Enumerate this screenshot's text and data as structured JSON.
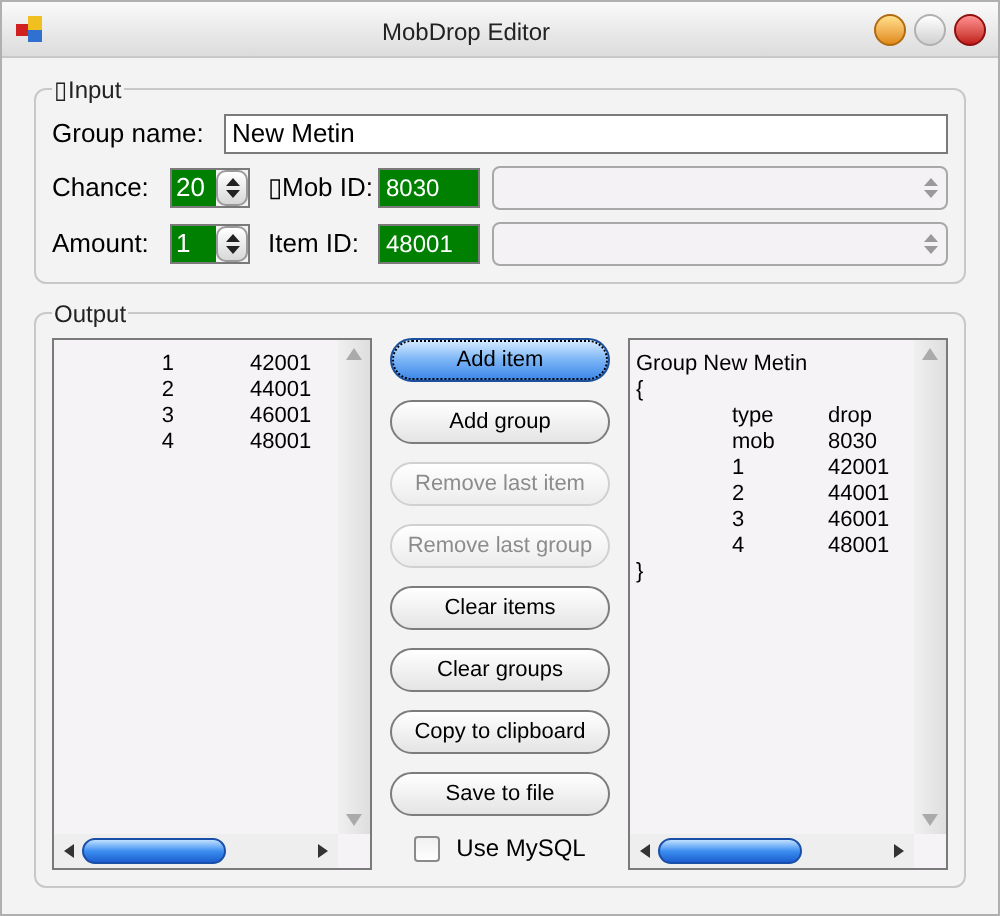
{
  "window": {
    "title": "MobDrop Editor"
  },
  "input": {
    "title": "▯Input",
    "group_name_label": "Group name:",
    "group_name": "New Metin",
    "chance_label": "Chance:",
    "chance": "20",
    "mob_id_label": "▯Mob ID:",
    "mob_id": "8030",
    "amount_label": "Amount:",
    "amount": "1",
    "item_id_label": "Item ID:",
    "item_id": "48001"
  },
  "output": {
    "title": "Output",
    "items": [
      {
        "index": "1",
        "id": "42001"
      },
      {
        "index": "2",
        "id": "44001"
      },
      {
        "index": "3",
        "id": "46001"
      },
      {
        "index": "4",
        "id": "48001"
      }
    ],
    "buttons": [
      {
        "label": "Add item",
        "default": true,
        "disabled": false
      },
      {
        "label": "Add group",
        "default": false,
        "disabled": false
      },
      {
        "label": "Remove last item",
        "default": false,
        "disabled": true
      },
      {
        "label": "Remove last group",
        "default": false,
        "disabled": true
      },
      {
        "label": "Clear items",
        "default": false,
        "disabled": false
      },
      {
        "label": "Clear groups",
        "default": false,
        "disabled": false
      },
      {
        "label": "Copy to clipboard",
        "default": false,
        "disabled": false
      },
      {
        "label": "Save to file",
        "default": false,
        "disabled": false
      }
    ],
    "use_mysql": {
      "label": "Use MySQL",
      "checked": false
    },
    "preview": {
      "header": "Group New Metin",
      "open": "{",
      "rows": [
        {
          "col1": "type",
          "col2": "drop"
        },
        {
          "col1": "mob",
          "col2": "8030"
        },
        {
          "col1": "1",
          "col2": "42001"
        },
        {
          "col1": "2",
          "col2": "44001"
        },
        {
          "col1": "3",
          "col2": "46001"
        },
        {
          "col1": "4",
          "col2": "48001"
        }
      ],
      "close": "}"
    }
  }
}
